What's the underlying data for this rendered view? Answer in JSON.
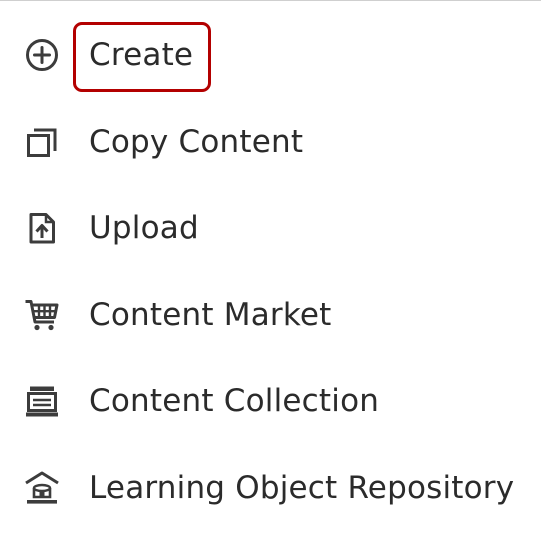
{
  "menu": {
    "items": [
      {
        "label": "Create",
        "icon": "plus-circle-icon",
        "highlighted": true
      },
      {
        "label": "Copy Content",
        "icon": "copy-icon",
        "highlighted": false
      },
      {
        "label": "Upload",
        "icon": "upload-file-icon",
        "highlighted": false
      },
      {
        "label": "Content Market",
        "icon": "cart-icon",
        "highlighted": false
      },
      {
        "label": "Content Collection",
        "icon": "collection-icon",
        "highlighted": false
      },
      {
        "label": "Learning Object Repository",
        "icon": "repository-icon",
        "highlighted": false
      }
    ]
  },
  "colors": {
    "text": "#2b2b2b",
    "icon": "#3c3c3c",
    "highlight": "#b30000",
    "divider": "#cfcfcf"
  }
}
